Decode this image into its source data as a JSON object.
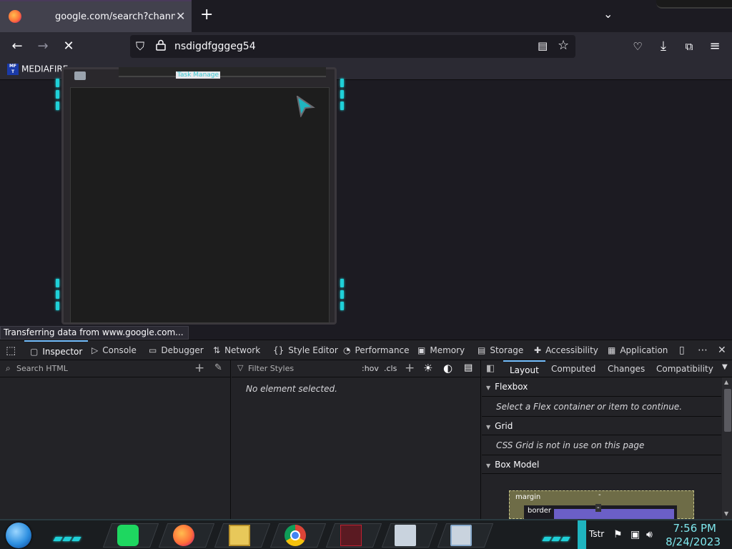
{
  "browser": {
    "tab": {
      "title": "google.com/search?channel=fe"
    },
    "url": "nsdigdfgggeg54",
    "bookmark": "MEDIAFIRE",
    "status_text": "Transferring data from www.google.com..."
  },
  "widget": {
    "title": "Task Manage"
  },
  "devtools": {
    "tabs": [
      "Inspector",
      "Console",
      "Debugger",
      "Network",
      "Style Editor",
      "Performance",
      "Memory",
      "Storage",
      "Accessibility",
      "Application"
    ],
    "search_html_placeholder": "Search HTML",
    "filter_styles_placeholder": "Filter Styles",
    "hov": ":hov",
    "cls": ".cls",
    "no_element": "No element selected.",
    "layout_tabs": [
      "Layout",
      "Computed",
      "Changes",
      "Compatibility"
    ],
    "sections": {
      "flexbox": {
        "label": "Flexbox",
        "note": "Select a Flex container or item to continue."
      },
      "grid": {
        "label": "Grid",
        "note": "CSS Grid is not in use on this page"
      },
      "boxmodel": {
        "label": "Box Model",
        "margin": "margin",
        "border": "border",
        "dash": "-"
      }
    }
  },
  "taskbar": {
    "time": "7:56 PM",
    "date": "8/24/2023",
    "tray_text": "Tstr"
  },
  "colors": {
    "accent": "#75bfff",
    "led": "#1fd0d8",
    "clock": "#7ee6ec"
  }
}
